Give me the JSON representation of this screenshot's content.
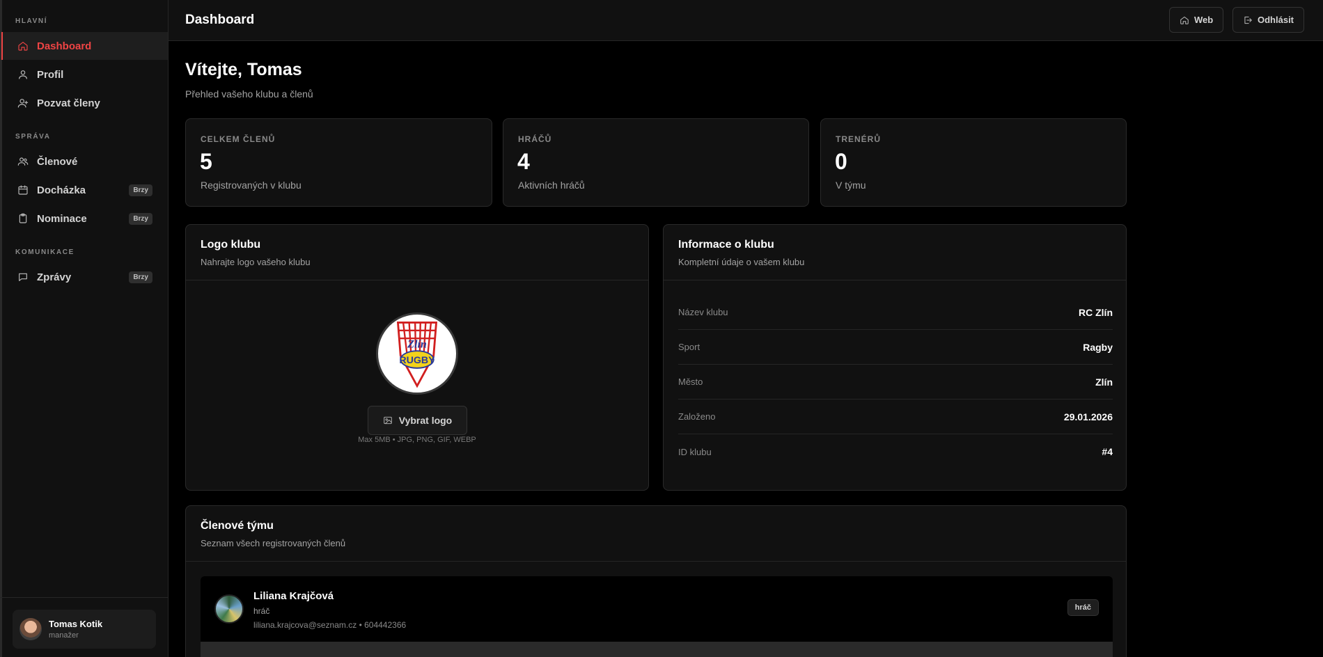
{
  "sidebar": {
    "sections": [
      {
        "title": "HLAVNÍ",
        "items": [
          {
            "label": "Dashboard",
            "icon": "home-icon",
            "active": true
          },
          {
            "label": "Profil",
            "icon": "user-icon"
          },
          {
            "label": "Pozvat členy",
            "icon": "user-plus-icon"
          }
        ]
      },
      {
        "title": "SPRÁVA",
        "items": [
          {
            "label": "Členové",
            "icon": "users-icon"
          },
          {
            "label": "Docházka",
            "icon": "calendar-icon",
            "badge": "Brzy"
          },
          {
            "label": "Nominace",
            "icon": "clipboard-icon",
            "badge": "Brzy"
          }
        ]
      },
      {
        "title": "KOMUNIKACE",
        "items": [
          {
            "label": "Zprávy",
            "icon": "message-icon",
            "badge": "Brzy"
          }
        ]
      }
    ],
    "user": {
      "name": "Tomas Kotik",
      "role": "manažer"
    }
  },
  "header": {
    "title": "Dashboard",
    "web_label": "Web",
    "logout_label": "Odhlásit"
  },
  "welcome": {
    "title": "Vítejte, Tomas",
    "subtitle": "Přehled vašeho klubu a členů"
  },
  "stats": [
    {
      "label": "CELKEM ČLENŮ",
      "value": "5",
      "desc": "Registrovaných v klubu"
    },
    {
      "label": "HRÁČŮ",
      "value": "4",
      "desc": "Aktivních hráčů"
    },
    {
      "label": "TRENÉRŮ",
      "value": "0",
      "desc": "V týmu"
    }
  ],
  "logo_card": {
    "title": "Logo klubu",
    "subtitle": "Nahrajte logo vašeho klubu",
    "button_label": "Vybrat logo",
    "hint": "Max 5MB • JPG, PNG, GIF, WEBP",
    "logo_text_top": "Zlín",
    "logo_text_main": "RUGBY"
  },
  "info_card": {
    "title": "Informace o klubu",
    "subtitle": "Kompletní údaje o vašem klubu",
    "rows": [
      {
        "key": "Název klubu",
        "value": "RC Zlín"
      },
      {
        "key": "Sport",
        "value": "Ragby"
      },
      {
        "key": "Město",
        "value": "Zlín"
      },
      {
        "key": "Založeno",
        "value": "29.01.2026"
      },
      {
        "key": "ID klubu",
        "value": "#4"
      }
    ]
  },
  "members_card": {
    "title": "Členové týmu",
    "subtitle": "Seznam všech registrovaných členů",
    "members": [
      {
        "name": "Liliana Krajčová",
        "role": "hráč",
        "contact": "liliana.krajcova@seznam.cz • 604442366",
        "badge": "hráč"
      }
    ]
  },
  "colors": {
    "accent": "#ef4444",
    "background": "#000000",
    "card": "#111111",
    "border": "#2a2a2a"
  }
}
